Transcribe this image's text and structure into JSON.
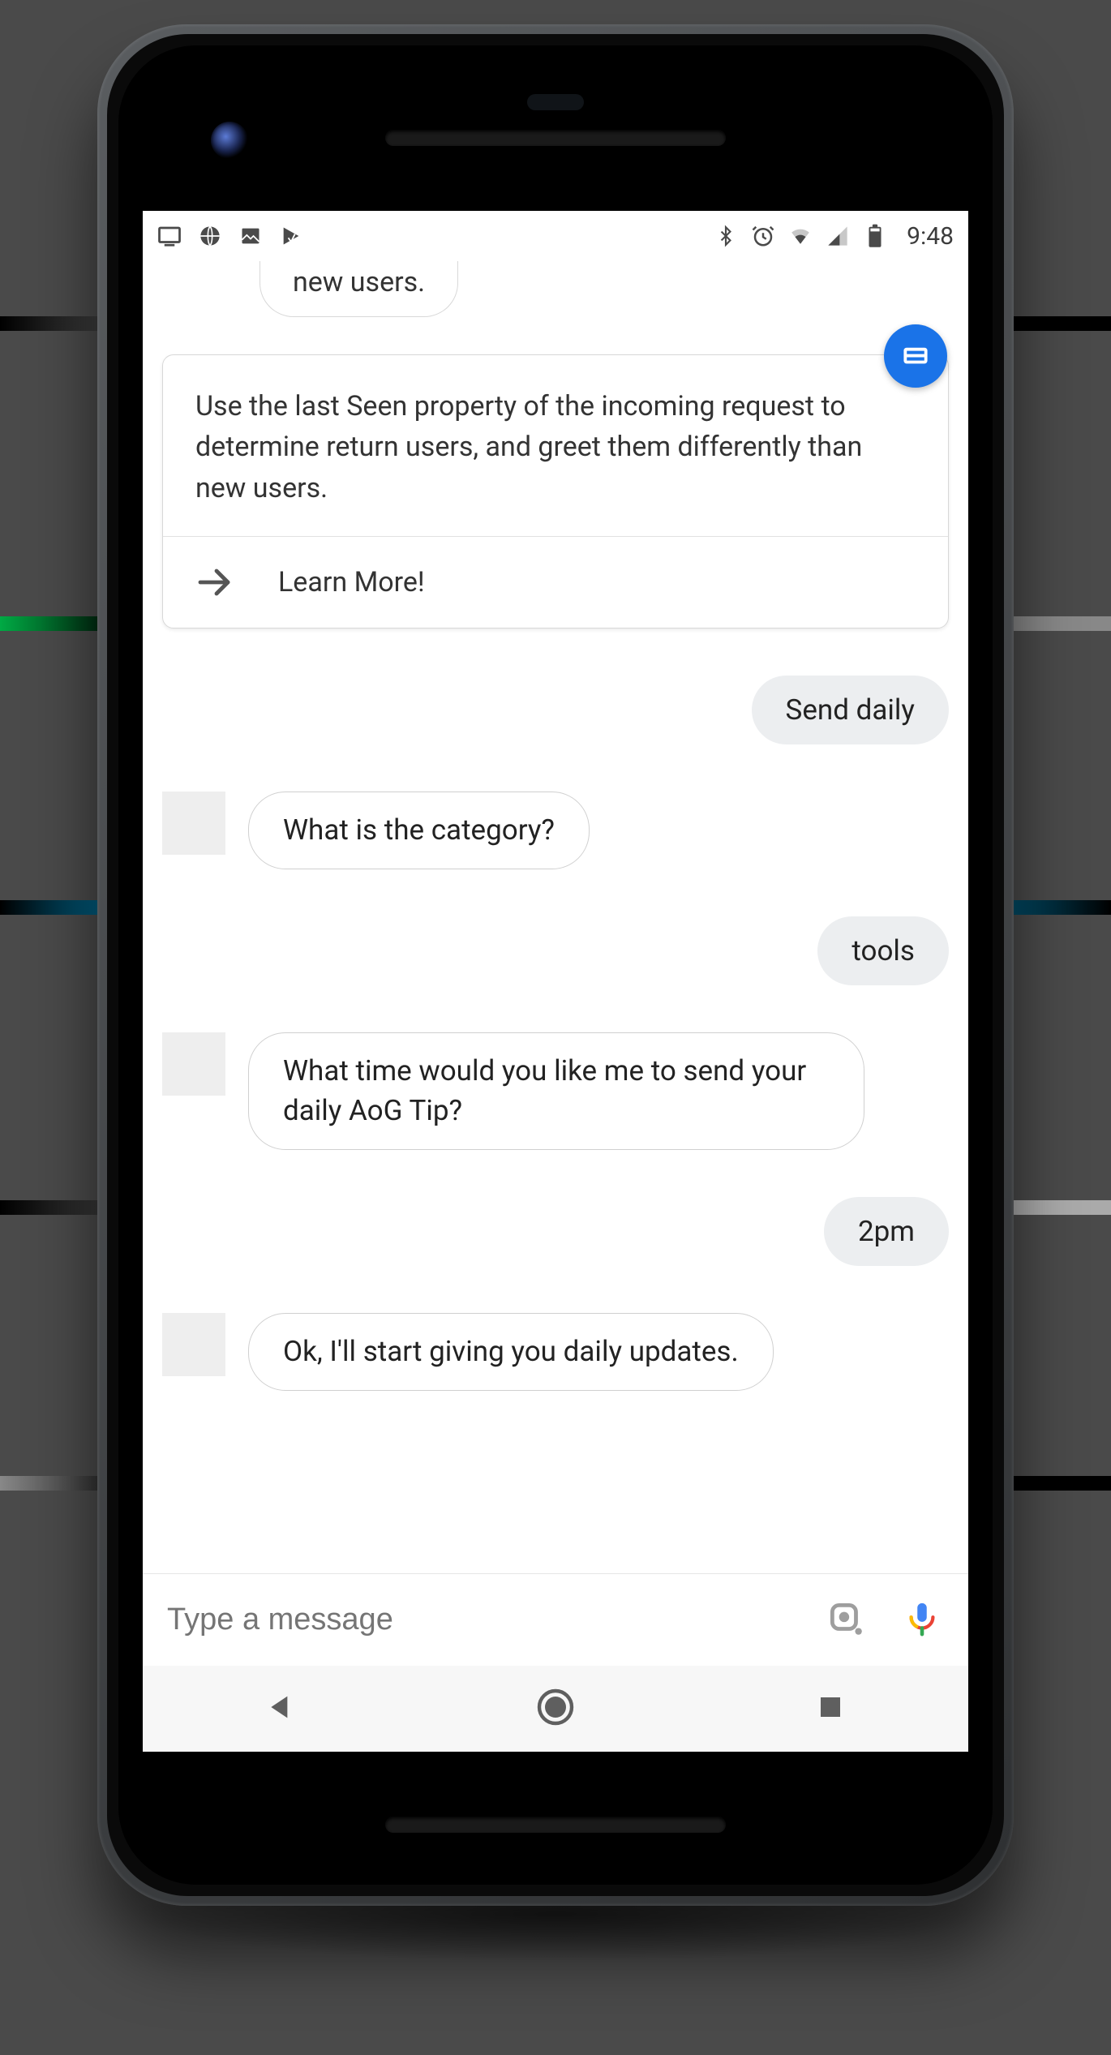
{
  "status": {
    "time": "9:48",
    "left_icons": [
      "cast-icon",
      "sports-icon",
      "photo-icon",
      "play-icon"
    ],
    "right_icons": [
      "bluetooth-icon",
      "alarm-icon",
      "wifi-icon",
      "cell-icon",
      "battery-icon"
    ]
  },
  "partial_bubble_text": "new users.",
  "card": {
    "body": "Use the last Seen property of the incoming request to determine return users, and greet them differently than new users.",
    "action_label": "Learn More!"
  },
  "conversation": [
    {
      "role": "user",
      "text": "Send daily"
    },
    {
      "role": "bot",
      "text": "What is the category?"
    },
    {
      "role": "user",
      "text": "tools"
    },
    {
      "role": "bot",
      "text": "What time would you like me to send your daily AoG Tip?"
    },
    {
      "role": "user",
      "text": "2pm"
    },
    {
      "role": "bot",
      "text": "Ok, I'll start giving you daily updates."
    }
  ],
  "composer": {
    "placeholder": "Type a message"
  },
  "colors": {
    "accent": "#1a73e8",
    "user_bubble": "#eceef0"
  }
}
